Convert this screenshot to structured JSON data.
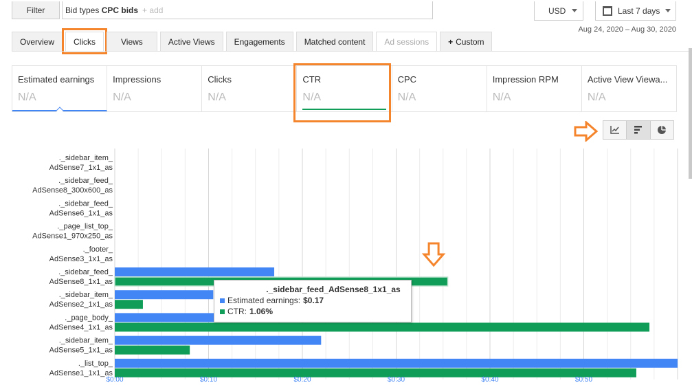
{
  "filter": {
    "button_label": "Filter",
    "chip_prefix": "Bid types",
    "chip_value": "CPC bids",
    "add_placeholder": "+ add"
  },
  "currency": "USD",
  "daterange": {
    "label": "Last 7 days",
    "range_text": "Aug 24, 2020 – Aug 30, 2020"
  },
  "tabs": [
    {
      "label": "Overview"
    },
    {
      "label": "Clicks"
    },
    {
      "label": "Views"
    },
    {
      "label": "Active Views"
    },
    {
      "label": "Engagements"
    },
    {
      "label": "Matched content"
    },
    {
      "label": "Ad sessions"
    },
    {
      "label": "Custom"
    }
  ],
  "metrics": [
    {
      "title": "Estimated earnings",
      "value": "N/A"
    },
    {
      "title": "Impressions",
      "value": "N/A"
    },
    {
      "title": "Clicks",
      "value": "N/A"
    },
    {
      "title": "CTR",
      "value": "N/A"
    },
    {
      "title": "CPC",
      "value": "N/A"
    },
    {
      "title": "Impression RPM",
      "value": "N/A"
    },
    {
      "title": "Active View Viewa...",
      "value": "N/A"
    }
  ],
  "colors": {
    "earnings": "#4285f4",
    "ctr": "#0f9d58",
    "highlight": "#f5852c"
  },
  "chart_data": {
    "type": "bar",
    "orientation": "horizontal",
    "categories": [
      [
        "._sidebar_item_",
        "AdSense7_1x1_as"
      ],
      [
        "._sidebar_feed_",
        "AdSense8_300x600_as"
      ],
      [
        "._sidebar_feed_",
        "AdSense6_1x1_as"
      ],
      [
        "._page_list_top_",
        "AdSense1_970x250_as"
      ],
      [
        "._footer_",
        "AdSense3_1x1_as"
      ],
      [
        "._sidebar_feed_",
        "AdSense8_1x1_as"
      ],
      [
        "._sidebar_item_",
        "AdSense2_1x1_as"
      ],
      [
        "._page_body_",
        "AdSense4_1x1_as"
      ],
      [
        "._sidebar_item_",
        "AdSense5_1x1_as"
      ],
      [
        "._list_top_",
        "AdSense1_1x1_as"
      ]
    ],
    "series": [
      {
        "name": "Estimated earnings",
        "values": [
          0,
          0,
          0,
          0,
          0,
          0.17,
          0.105,
          0.11,
          0.22,
          0.6
        ]
      },
      {
        "name": "CTR",
        "values": [
          0,
          0,
          0,
          0,
          0,
          0.355,
          0.03,
          0.57,
          0.08,
          0.556
        ]
      }
    ],
    "xticks": [
      "$0.00",
      "$0.10",
      "$0.20",
      "$0.30",
      "$0.40",
      "$0.50"
    ],
    "xlim": [
      0,
      0.6
    ]
  },
  "tooltip": {
    "title": "._sidebar_feed_AdSense8_1x1_as",
    "earnings_label": "Estimated earnings:",
    "earnings_value": "$0.17",
    "ctr_label": "CTR:",
    "ctr_value": "1.06%"
  }
}
